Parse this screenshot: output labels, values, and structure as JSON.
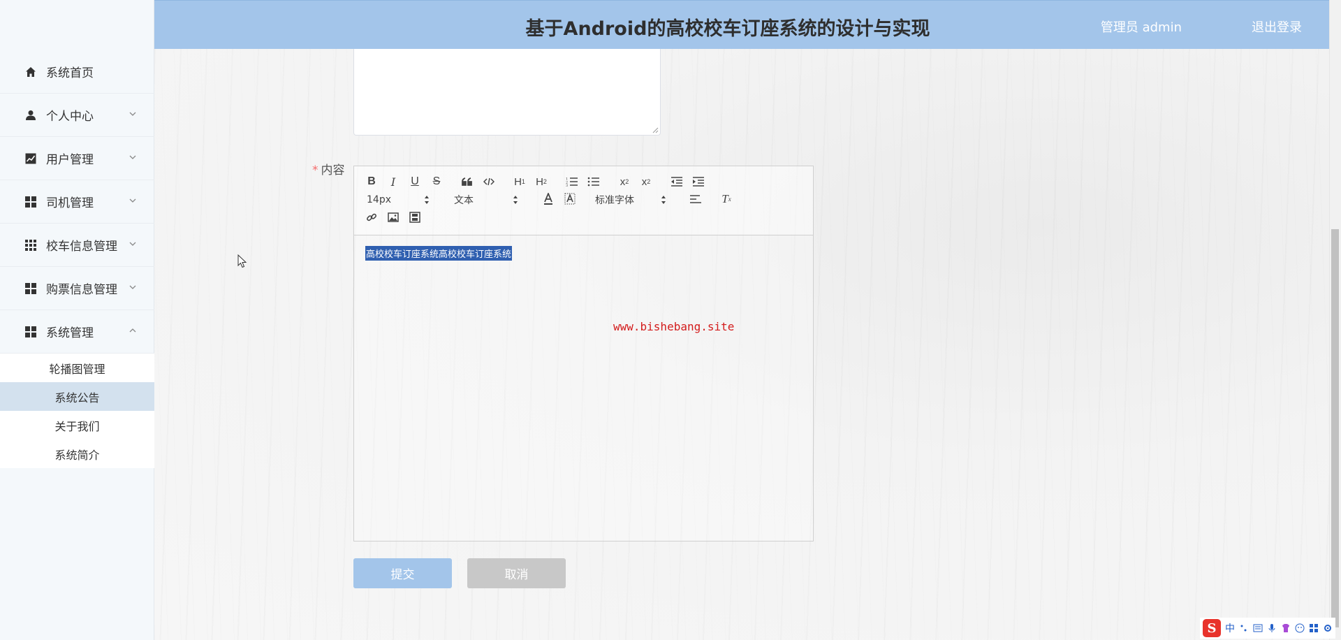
{
  "header": {
    "title": "基于Android的高校校车订座系统的设计与实现",
    "admin_label": "管理员 admin",
    "logout_label": "退出登录"
  },
  "sidebar": {
    "items": [
      {
        "label": "系统首页",
        "icon": "home-icon",
        "expandable": false
      },
      {
        "label": "个人中心",
        "icon": "user-icon",
        "expandable": true
      },
      {
        "label": "用户管理",
        "icon": "chart-icon",
        "expandable": true
      },
      {
        "label": "司机管理",
        "icon": "grid-icon",
        "expandable": true
      },
      {
        "label": "校车信息管理",
        "icon": "apps-icon",
        "expandable": true
      },
      {
        "label": "购票信息管理",
        "icon": "grid-icon",
        "expandable": true
      },
      {
        "label": "系统管理",
        "icon": "grid-icon",
        "expandable": true,
        "expanded": true
      }
    ],
    "submenu": [
      {
        "label": "轮播图管理"
      },
      {
        "label": "系统公告",
        "active": true
      },
      {
        "label": "关于我们"
      },
      {
        "label": "系统简介"
      }
    ]
  },
  "form": {
    "content_label_star": "*",
    "content_label": "内容"
  },
  "editor": {
    "font_size": "14px",
    "header_type": "文本",
    "font_family": "标准字体",
    "selected_text": "高校校车订座系统高校校车订座系统",
    "toolbar_icons": [
      "bold-icon",
      "italic-icon",
      "underline-icon",
      "strike-icon",
      "blockquote-icon",
      "code-block-icon",
      "h1-icon",
      "h2-icon",
      "ordered-list-icon",
      "bullet-list-icon",
      "subscript-icon",
      "superscript-icon",
      "outdent-icon",
      "indent-icon",
      "font-color-icon",
      "background-color-icon",
      "align-icon",
      "clear-format-icon",
      "link-icon",
      "image-icon",
      "video-icon"
    ]
  },
  "watermark": "www.bishebang.site",
  "buttons": {
    "submit_label": "提交",
    "cancel_label": "取消"
  },
  "ime": {
    "logo": "S",
    "lang": "中"
  },
  "colors": {
    "header_bg": "#a3c5ea",
    "submit_bg": "#a3c5ea",
    "cancel_bg": "#c8c8c8",
    "active_submenu_bg": "#d3e1ee",
    "selection_bg": "#2f5fb0",
    "watermark": "#d31b1b",
    "required_star": "#f56c6c"
  }
}
